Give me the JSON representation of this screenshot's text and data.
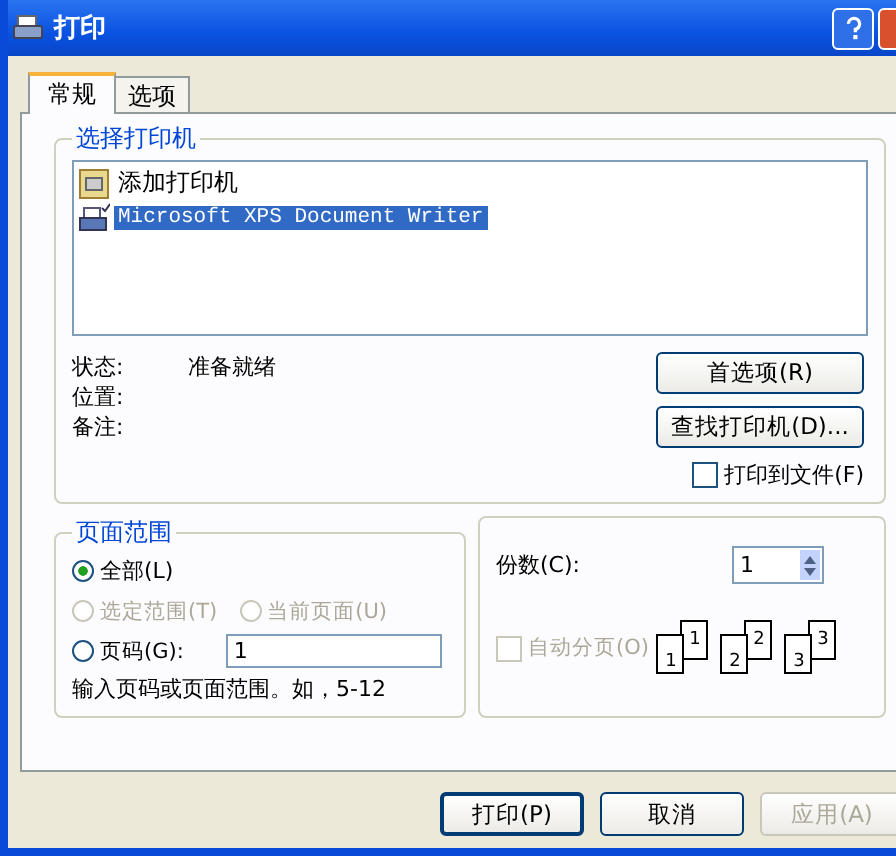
{
  "window": {
    "title": "打印"
  },
  "tabs": [
    {
      "label": "常规",
      "selected": true
    },
    {
      "label": "选项",
      "selected": false
    }
  ],
  "printer_group": {
    "title": "选择打印机",
    "items": [
      {
        "label": "添加打印机",
        "kind": "add",
        "selected": false
      },
      {
        "label": "Microsoft XPS Document Writer",
        "kind": "printer",
        "selected": true
      }
    ]
  },
  "info": [
    {
      "label": "状态:",
      "value": "准备就绪"
    },
    {
      "label": "位置:"
    },
    {
      "label": "备注:"
    }
  ],
  "preferences_button": "首选项(R)",
  "find_printer_button": "查找打印机(D)...",
  "print_to_file": {
    "label": "打印到文件(F)",
    "checked": false
  },
  "page_range": {
    "title": "页面范围",
    "options": [
      {
        "label": "全部(L)",
        "selected": true,
        "disabled": false
      },
      {
        "label": "选定范围(T)",
        "selected": false,
        "disabled": true
      },
      {
        "label": "当前页面(U)",
        "selected": false,
        "disabled": true
      },
      {
        "label": "页码(G):",
        "selected": false,
        "disabled": false,
        "value": "1"
      }
    ],
    "hint": "输入页码或页面范围。如，5-12"
  },
  "copies": {
    "label": "份数(C):",
    "value": "1",
    "collate": {
      "label": "自动分页(O)",
      "checked": false,
      "disabled": true
    },
    "collate_pages": [
      {
        "front": "1",
        "back": "1"
      },
      {
        "front": "2",
        "back": "2"
      },
      {
        "front": "3",
        "back": "3"
      }
    ]
  },
  "buttons": [
    {
      "label": "打印(P)",
      "disabled": false,
      "default": true
    },
    {
      "label": "取消",
      "disabled": false,
      "default": false
    },
    {
      "label": "应用(A)",
      "disabled": true,
      "default": false
    }
  ]
}
